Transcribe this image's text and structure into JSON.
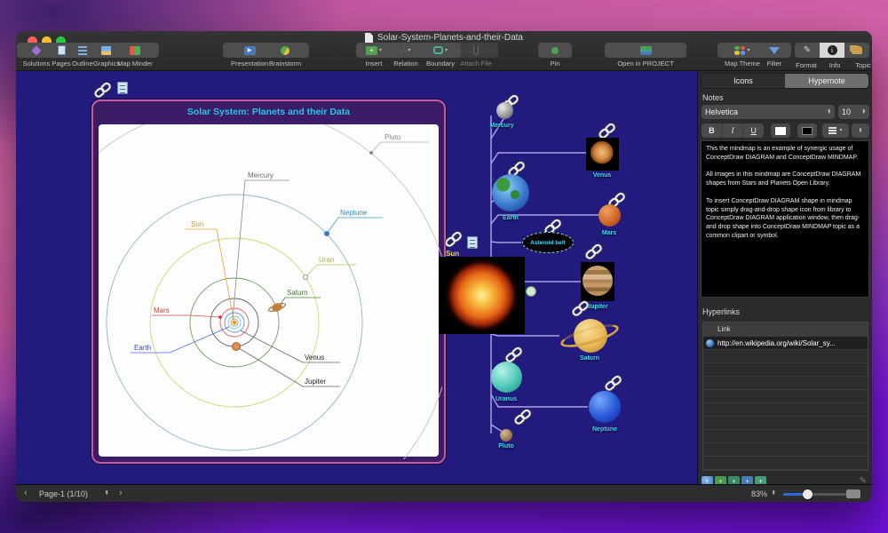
{
  "window": {
    "title": "Solar-System-Planets-and-their-Data"
  },
  "toolbar": {
    "items": [
      {
        "label": "Solutions"
      },
      {
        "label": "Pages"
      },
      {
        "label": "Outline"
      },
      {
        "label": "Graphics"
      },
      {
        "label": "Map Minder"
      },
      {
        "label": "Presentation"
      },
      {
        "label": "Brainstorm"
      },
      {
        "label": "Insert"
      },
      {
        "label": "Relation"
      },
      {
        "label": "Boundary"
      },
      {
        "label": "Attach File"
      },
      {
        "label": "Pin"
      },
      {
        "label": "Open in PROJECT"
      },
      {
        "label": "Map Theme"
      },
      {
        "label": "Filter"
      },
      {
        "label": "Format"
      },
      {
        "label": "Info"
      },
      {
        "label": "Topic"
      }
    ]
  },
  "diagram": {
    "title": "Solar System: Planets and their Data",
    "labels": {
      "pluto": "Pluto",
      "mercury": "Mercury",
      "neptune": "Neptune",
      "sun": "Sun",
      "uranus": "Uran",
      "saturn": "Saturn",
      "mars": "Mars",
      "earth": "Earth",
      "venus": "Venus",
      "jupiter": "Jupiter"
    }
  },
  "mindmap": {
    "nodes": {
      "mercury": "Mercury",
      "venus": "Venus",
      "earth": "Earth",
      "mars": "Mars",
      "asteroid_belt": "Asteroid belt",
      "sun": "Sun",
      "jupiter": "Jupiter",
      "saturn": "Saturn",
      "uranus": "Uranus",
      "neptune": "Neptune",
      "pluto": "Pluto"
    }
  },
  "panel": {
    "tabs": {
      "icons": "Icons",
      "hypernote": "Hypernote"
    },
    "notes_label": "Notes",
    "font_name": "Helvetica",
    "font_size": "10",
    "bold": "B",
    "italic": "I",
    "underline": "U",
    "notes_text": "This the mindmap is an example of synergic usage of ConceptDraw DIAGRAM and ConceptDraw MINDMAP.\n\nAll images in this mindmap are ConceptDraw DIAGRAM shapes from Stars and Planets Open Library.\n\nTo insert ConceptDraw DIAGRAM shape in mindmap topic simply drag-and-drop shape icon from library to ConceptDraw DIAGRAM application window, then drag-and drop shape into ConceptDraw MINDMAP topic as a common clipart or symbol.",
    "hyperlinks_label": "Hyperlinks",
    "link_header": "Link",
    "link_url": "http://en.wikipedia.org/wiki/Solar_sy..."
  },
  "statusbar": {
    "page": "Page-1 (1/10)",
    "zoom": "83%"
  },
  "colors": {
    "accent_cyan": "#29c5e6",
    "canvas_blue": "#221b7d",
    "frame_pink": "#c45ba8",
    "frame_purple": "#3a1d66"
  }
}
